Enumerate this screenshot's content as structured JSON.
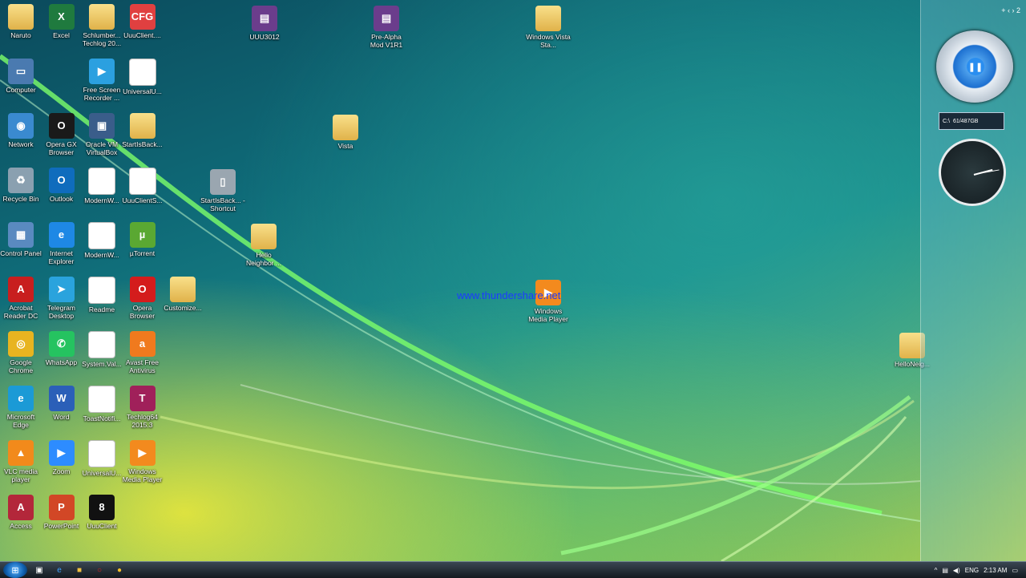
{
  "desktop_icons": [
    {
      "label": "Naruto",
      "icon": "folder-icon",
      "col": 0,
      "row": 0
    },
    {
      "label": "Excel",
      "icon": "excel-icon",
      "col": 1,
      "row": 0
    },
    {
      "label": "Schlumber... Techlog 20...",
      "icon": "folder-icon",
      "col": 2,
      "row": 0
    },
    {
      "label": "UuuClient....",
      "icon": "cfg-file-icon",
      "col": 3,
      "row": 0
    },
    {
      "label": "Computer",
      "icon": "computer-icon",
      "col": 0,
      "row": 1
    },
    {
      "label": "Free Screen Recorder ...",
      "icon": "screen-recorder-icon",
      "col": 2,
      "row": 1
    },
    {
      "label": "UniversalU...",
      "icon": "document-icon",
      "col": 3,
      "row": 1
    },
    {
      "label": "Network",
      "icon": "network-icon",
      "col": 0,
      "row": 2
    },
    {
      "label": "Opera GX Browser",
      "icon": "opera-gx-icon",
      "col": 1,
      "row": 2
    },
    {
      "label": "Oracle VM VirtualBox",
      "icon": "virtualbox-icon",
      "col": 2,
      "row": 2
    },
    {
      "label": "StartIsBack...",
      "icon": "folder-icon",
      "col": 3,
      "row": 2
    },
    {
      "label": "Recycle Bin",
      "icon": "recycle-bin-icon",
      "col": 0,
      "row": 3
    },
    {
      "label": "Outlook",
      "icon": "outlook-icon",
      "col": 1,
      "row": 3
    },
    {
      "label": "ModernW...",
      "icon": "config-file-icon",
      "col": 2,
      "row": 3
    },
    {
      "label": "UuuClientS...",
      "icon": "settings-file-icon",
      "col": 3,
      "row": 3
    },
    {
      "label": "Control Panel",
      "icon": "control-panel-icon",
      "col": 0,
      "row": 4
    },
    {
      "label": "Internet Explorer",
      "icon": "internet-explorer-icon",
      "col": 1,
      "row": 4
    },
    {
      "label": "ModernW...",
      "icon": "config-file-icon",
      "col": 2,
      "row": 4
    },
    {
      "label": "µTorrent",
      "icon": "utorrent-icon",
      "col": 3,
      "row": 4
    },
    {
      "label": "Acrobat Reader DC",
      "icon": "acrobat-icon",
      "col": 0,
      "row": 5
    },
    {
      "label": "Telegram Desktop",
      "icon": "telegram-icon",
      "col": 1,
      "row": 5
    },
    {
      "label": "Readme",
      "icon": "document-icon",
      "col": 2,
      "row": 5
    },
    {
      "label": "Opera Browser",
      "icon": "opera-icon",
      "col": 3,
      "row": 5
    },
    {
      "label": "Customize...",
      "icon": "folder-icon",
      "col": 4,
      "row": 5
    },
    {
      "label": "Google Chrome",
      "icon": "chrome-icon",
      "col": 0,
      "row": 6
    },
    {
      "label": "WhatsApp",
      "icon": "whatsapp-icon",
      "col": 1,
      "row": 6
    },
    {
      "label": "System.Val...",
      "icon": "config-file-icon",
      "col": 2,
      "row": 6
    },
    {
      "label": "Avast Free Antivirus",
      "icon": "avast-icon",
      "col": 3,
      "row": 6
    },
    {
      "label": "Microsoft Edge",
      "icon": "edge-icon",
      "col": 0,
      "row": 7
    },
    {
      "label": "Word",
      "icon": "word-icon",
      "col": 1,
      "row": 7
    },
    {
      "label": "ToastNotifi...",
      "icon": "config-file-icon",
      "col": 2,
      "row": 7
    },
    {
      "label": "Techlog64 2015.3",
      "icon": "techlog-icon",
      "col": 3,
      "row": 7
    },
    {
      "label": "VLC media player",
      "icon": "vlc-icon",
      "col": 0,
      "row": 8
    },
    {
      "label": "Zoom",
      "icon": "zoom-icon",
      "col": 1,
      "row": 8
    },
    {
      "label": "UniversalU...",
      "icon": "config-file-icon",
      "col": 2,
      "row": 8
    },
    {
      "label": "Windows Media Player",
      "icon": "media-player-icon",
      "col": 3,
      "row": 8
    },
    {
      "label": "Access",
      "icon": "access-icon",
      "col": 0,
      "row": 9
    },
    {
      "label": "PowerPoint",
      "icon": "powerpoint-icon",
      "col": 1,
      "row": 9
    },
    {
      "label": "UuuClient",
      "icon": "uuuclient-icon",
      "col": 2,
      "row": 9
    }
  ],
  "floating_icons": [
    {
      "label": "UUU3012",
      "icon": "winrar-icon",
      "pos": "uuu"
    },
    {
      "label": "Pre-Alpha Mod V1R1",
      "icon": "winrar-icon",
      "pos": "prealpha"
    },
    {
      "label": "Windows Vista Sta...",
      "icon": "folder-icon",
      "pos": "vista-sta"
    },
    {
      "label": "Vista",
      "icon": "folder-icon",
      "pos": "vista"
    },
    {
      "label": "StartIsBack... - Shortcut",
      "icon": "startisback-shortcut-icon",
      "pos": "sib"
    },
    {
      "label": "Hello Neighbor ...",
      "icon": "folder-icon",
      "pos": "hello"
    },
    {
      "label": "Windows Media Player",
      "icon": "media-player-icon",
      "pos": "wmp"
    },
    {
      "label": "HelloNeig...",
      "icon": "folder-icon",
      "pos": "hello2"
    }
  ],
  "watermark": "www.thundershare.net",
  "sidebar": {
    "header_controls": "+ ‹ › 2",
    "disk_label": "C:\\",
    "disk_value": "61/487GB"
  },
  "taskbar": {
    "language": "ENG",
    "time": "2:13 AM"
  },
  "colors": {
    "taskbar": "#1b232b",
    "watermark": "#1d3bff"
  }
}
